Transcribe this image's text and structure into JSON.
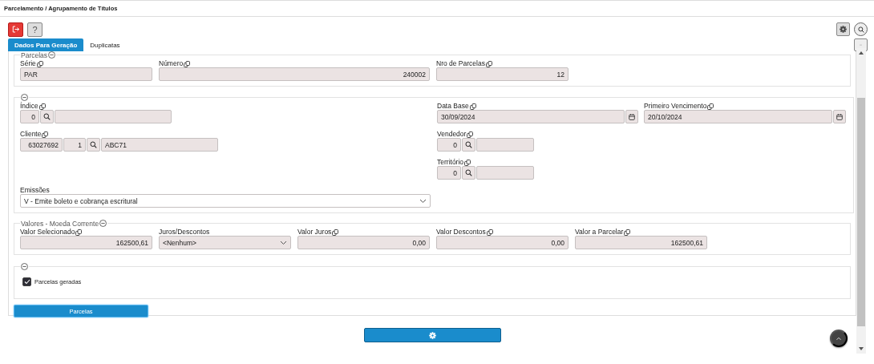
{
  "title": "Parcelamento / Agrupamento de Títulos",
  "toolbar": {
    "left": [
      {
        "kind": "exit"
      },
      {
        "kind": "help",
        "label": "?"
      }
    ],
    "right": [
      {
        "kind": "settings"
      },
      {
        "kind": "search"
      }
    ]
  },
  "tabs": [
    {
      "label": "Dados Para Geração",
      "selected": true
    },
    {
      "label": "Duplicatas",
      "selected": false
    }
  ],
  "parcelas": {
    "legend": "Parcelas",
    "fields": [
      {
        "kind": "text",
        "label": "Série",
        "copy": true,
        "value": "PAR"
      },
      {
        "kind": "number_wide",
        "label": "Número",
        "copy": true,
        "value": "240002"
      },
      {
        "kind": "number",
        "label": "Nro de Parcelas",
        "copy": true,
        "value": "12"
      }
    ]
  },
  "dados": {
    "left": [
      {
        "kind": "lookup",
        "label": "Índice",
        "copy": true,
        "code": "0"
      },
      {
        "kind": "lookup_branch",
        "label": "Cliente",
        "copy": true,
        "code": "63027692",
        "branch": "1",
        "description": "ABC71"
      }
    ],
    "dates": [
      {
        "label": "Data Base",
        "copy": true,
        "value": "30/09/2024"
      },
      {
        "label": "Primeiro Vencimento",
        "copy": true,
        "value": "20/10/2024"
      }
    ],
    "right": [
      {
        "kind": "lookup",
        "label": "Vendedor",
        "copy": true,
        "code": "0"
      },
      {
        "kind": "lookup",
        "label": "Território",
        "copy": true,
        "code": "0"
      }
    ],
    "emissoes": {
      "label": "Emissões",
      "copy": false,
      "value": "V - Emite boleto e cobrança escritural"
    }
  },
  "valores": {
    "legend": "Valores - Moeda Corrente",
    "fields": [
      {
        "kind": "number",
        "label": "Valor Selecionado",
        "copy": true,
        "value": "162500,61"
      },
      {
        "kind": "select",
        "label": "Juros/Descontos",
        "copy": false,
        "value": "<Nenhum>"
      },
      {
        "kind": "number",
        "label": "Valor Juros",
        "copy": true,
        "value": "0,00"
      },
      {
        "kind": "number",
        "label": "Valor Descontos",
        "copy": true,
        "value": "0,00"
      },
      {
        "kind": "number",
        "label": "Valor a Parcelar",
        "copy": true,
        "value": "162500,61"
      }
    ]
  },
  "geradas": {
    "label": "Parcelas geradas",
    "checked": true
  },
  "parcelas_button": "Parcelas"
}
